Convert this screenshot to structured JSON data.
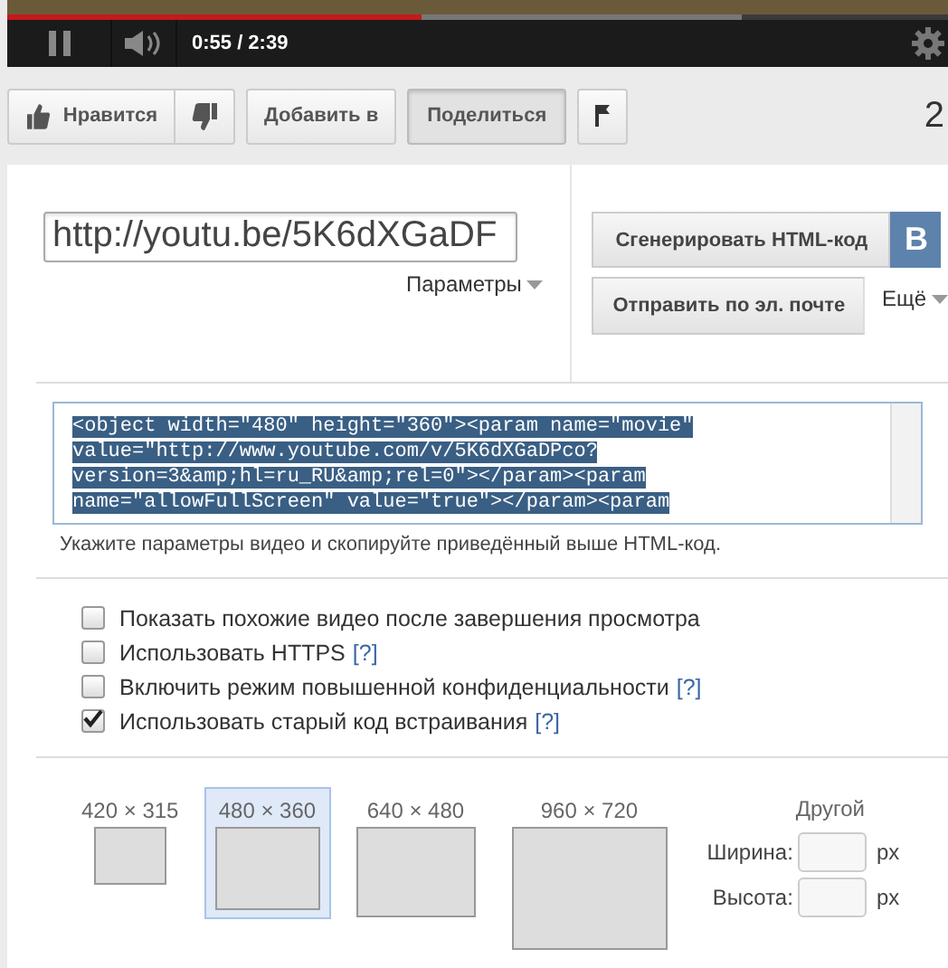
{
  "player": {
    "progress": {
      "level": 0.44
    },
    "playing": true,
    "time": "0:55 / 2:39"
  },
  "actions": {
    "like": "Нравится",
    "add": "Добавить в",
    "share": {
      "label": "Поделиться",
      "selected": true
    },
    "views": "2"
  },
  "share": {
    "url": "http://youtu.be/5K6dXGaDF",
    "params": "Параметры",
    "generate": "Сгенерировать HTML-код",
    "vk": "B",
    "email": "Отправить по эл. почте",
    "more": "Ещё"
  },
  "embed": {
    "code_lines": [
      "<object width=\"480\" height=\"360\"><param name=\"movie\"",
      "value=\"http://www.youtube.com/v/5K6dXGaDPco?",
      "version=3&amp;hl=ru_RU&amp;rel=0\"></param><param",
      "name=\"allowFullScreen\" value=\"true\"></param><param"
    ],
    "hint": "Укажите параметры видео и скопируйте приведённый выше HTML-код."
  },
  "options": [
    {
      "label": "Показать похожие видео после завершения просмотра",
      "checked": false
    },
    {
      "label": "Использовать HTTPS",
      "help": "[?]",
      "checked": false
    },
    {
      "label": "Включить режим повышенной конфиденциальности",
      "help": "[?]",
      "checked": false
    },
    {
      "label": "Использовать старый код встраивания",
      "help": "[?]",
      "checked": true
    }
  ],
  "sizes": [
    {
      "label": "420 × 315",
      "selected": false
    },
    {
      "label": "480 × 360",
      "selected": true
    },
    {
      "label": "640 × 480",
      "selected": false
    },
    {
      "label": "960 × 720",
      "selected": false
    }
  ],
  "custom": {
    "title": "Другой",
    "width_label": "Ширина:",
    "height_label": "Высота:",
    "unit_w": "px",
    "unit_h": "px"
  }
}
